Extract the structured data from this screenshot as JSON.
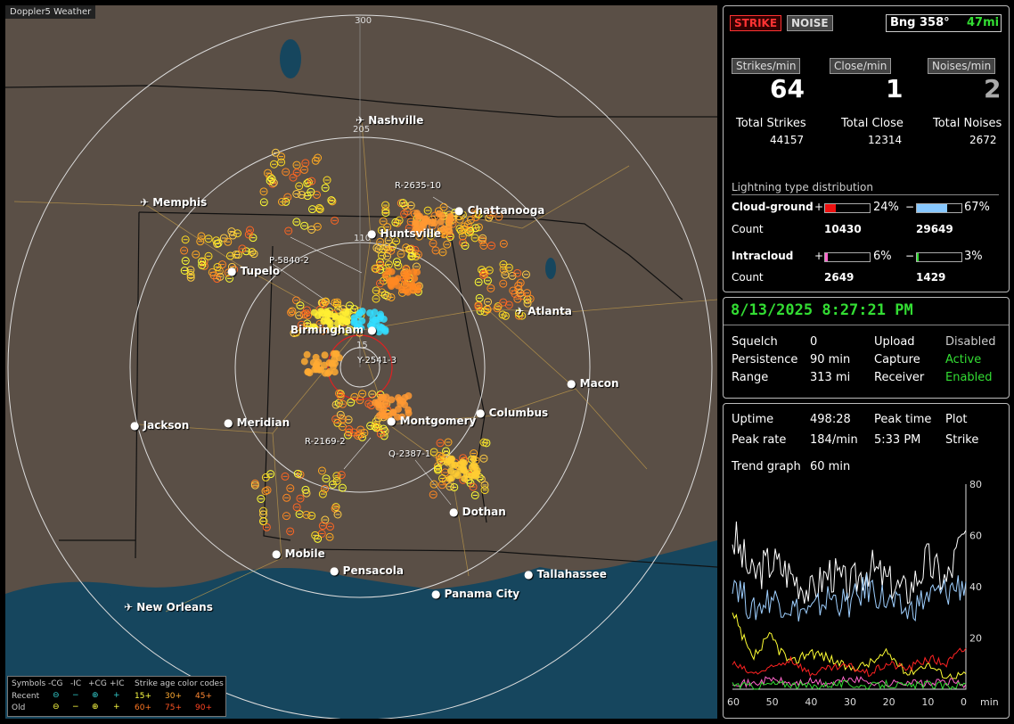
{
  "app": {
    "title": "Doppler5 Weather"
  },
  "map": {
    "range_labels": [
      "300",
      "205",
      "110",
      "15"
    ],
    "cities": [
      {
        "name": "Nashville",
        "airport": true
      },
      {
        "name": "Memphis",
        "airport": true
      },
      {
        "name": "Chattanooga",
        "airport": false
      },
      {
        "name": "Huntsville",
        "airport": false
      },
      {
        "name": "Tupelo",
        "airport": false
      },
      {
        "name": "Atlanta",
        "airport": true
      },
      {
        "name": "Birmingham",
        "airport": false
      },
      {
        "name": "Macon",
        "airport": false
      },
      {
        "name": "Jackson",
        "airport": false
      },
      {
        "name": "Meridian",
        "airport": false
      },
      {
        "name": "Montgomery",
        "airport": false
      },
      {
        "name": "Columbus",
        "airport": false
      },
      {
        "name": "Dothan",
        "airport": false
      },
      {
        "name": "Mobile",
        "airport": false
      },
      {
        "name": "Pensacola",
        "airport": false
      },
      {
        "name": "Tallahassee",
        "airport": false
      },
      {
        "name": "Panama City",
        "airport": false
      },
      {
        "name": "New Orleans",
        "airport": true
      }
    ],
    "storm_labels": [
      "R-2635-10",
      "P-5840-2",
      "Y-2541-3",
      "R-2169-2",
      "Q-2387-1"
    ],
    "legend": {
      "symbols_label": "Symbols",
      "headers": [
        "-CG",
        "-IC",
        "+CG",
        "+IC"
      ],
      "age_label": "Strike age color codes",
      "recent_label": "Recent",
      "old_label": "Old",
      "recent_ages": [
        "15+",
        "30+",
        "45+"
      ],
      "old_ages": [
        "60+",
        "75+",
        "90+"
      ]
    }
  },
  "status": {
    "mode_strike": "STRIKE",
    "mode_noise": "NOISE",
    "bearing": "Bng 358°",
    "distance": "47mi",
    "rates": [
      {
        "label": "Strikes/min",
        "value": "64",
        "total_label": "Total Strikes",
        "total": "44157"
      },
      {
        "label": "Close/min",
        "value": "1",
        "total_label": "Total Close",
        "total": "12314"
      },
      {
        "label": "Noises/min",
        "value": "2",
        "total_label": "Total Noises",
        "total": "2672"
      }
    ],
    "distribution": {
      "title": "Lightning type distribution",
      "cloud_ground": {
        "label": "Cloud-ground",
        "pos_pct": "24%",
        "neg_pct": "67%",
        "pos_fill": 0.24,
        "neg_fill": 0.67,
        "count_label": "Count",
        "pos_count": "10430",
        "neg_count": "29649"
      },
      "intracloud": {
        "label": "Intracloud",
        "pos_pct": "6%",
        "neg_pct": "3%",
        "pos_fill": 0.06,
        "neg_fill": 0.03,
        "count_label": "Count",
        "pos_count": "2649",
        "neg_count": "1429"
      },
      "plus": "+",
      "minus": "−"
    }
  },
  "settings": {
    "datetime": "8/13/2025 8:27:21 PM",
    "squelch_label": "Squelch",
    "squelch": "0",
    "persistence_label": "Persistence",
    "persistence": "90 min",
    "range_label": "Range",
    "range": "313 mi",
    "upload_label": "Upload",
    "upload": "Disabled",
    "capture_label": "Capture",
    "capture": "Active",
    "receiver_label": "Receiver",
    "receiver": "Enabled"
  },
  "trend": {
    "uptime_label": "Uptime",
    "uptime": "498:28",
    "peak_time_label": "Peak time",
    "peak_time": "5:33 PM",
    "plot_label": "Plot",
    "plot": "Strike",
    "peak_rate_label": "Peak rate",
    "peak_rate": "184/min",
    "trend_label": "Trend graph",
    "trend": "60 min"
  },
  "chart_data": {
    "type": "line",
    "x": [
      60,
      55,
      50,
      45,
      40,
      35,
      30,
      25,
      20,
      15,
      10,
      5,
      0
    ],
    "x_ticks": [
      "60",
      "50",
      "40",
      "30",
      "20",
      "10",
      "0"
    ],
    "xlabel": "min",
    "y_ticks": [
      "80",
      "60",
      "40",
      "20"
    ],
    "ylim": [
      0,
      80
    ],
    "series": [
      {
        "color": "#ffffff",
        "values": [
          60,
          44,
          50,
          45,
          38,
          46,
          40,
          48,
          42,
          38,
          50,
          42,
          62
        ]
      },
      {
        "color": "#9ecfff",
        "values": [
          45,
          30,
          36,
          32,
          30,
          36,
          33,
          40,
          34,
          30,
          36,
          38,
          42
        ]
      },
      {
        "color": "#ffff33",
        "values": [
          28,
          12,
          20,
          10,
          15,
          12,
          8,
          10,
          14,
          6,
          10,
          5,
          6
        ]
      },
      {
        "color": "#ff2222",
        "values": [
          10,
          6,
          8,
          12,
          6,
          8,
          9,
          6,
          10,
          8,
          12,
          10,
          16
        ]
      },
      {
        "color": "#ff66cc",
        "values": [
          3,
          2,
          4,
          2,
          3,
          2,
          4,
          3,
          2,
          3,
          2,
          3,
          2
        ]
      },
      {
        "color": "#33dd33",
        "values": [
          2,
          1,
          2,
          2,
          1,
          2,
          2,
          1,
          2,
          1,
          2,
          1,
          2
        ]
      }
    ]
  }
}
